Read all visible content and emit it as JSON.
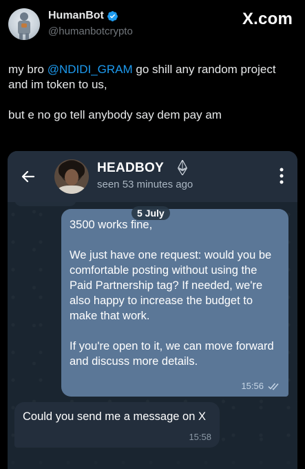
{
  "tweet": {
    "display_name": "HumanBot",
    "handle": "@humanbotcrypto",
    "source_logo": "X.com",
    "text_line1_prefix": "my bro ",
    "mention": "@NDIDI_GRAM",
    "text_line1_suffix": " go shill any random project and im token to us,",
    "text_line2": "but e no go tell anybody say dem pay am"
  },
  "chat": {
    "contact_name": "HEADBOY",
    "last_seen": "seen 53 minutes ago",
    "date_chip": "5 July",
    "outgoing": {
      "paragraphs": [
        "3500 works fine,",
        "We just have one request: would you be comfortable posting without using the Paid Partnership tag? If needed, we're also happy to increase the budget to make that work.",
        "If you're open to it, we can move forward and discuss more details."
      ],
      "time": "15:56"
    },
    "incoming": {
      "text": "Could you send me a message on X",
      "time": "15:58"
    }
  },
  "icons": {
    "verified": "verified-badge-icon",
    "back": "back-arrow-icon",
    "ethereum": "ethereum-icon",
    "more": "more-vertical-icon",
    "read_receipt": "double-check-icon"
  },
  "colors": {
    "mention": "#1d9bf0",
    "verified": "#1d9bf0",
    "outgoing_bubble": "#5b7797",
    "incoming_bubble": "#232e3c",
    "chat_header": "#232e3c"
  }
}
